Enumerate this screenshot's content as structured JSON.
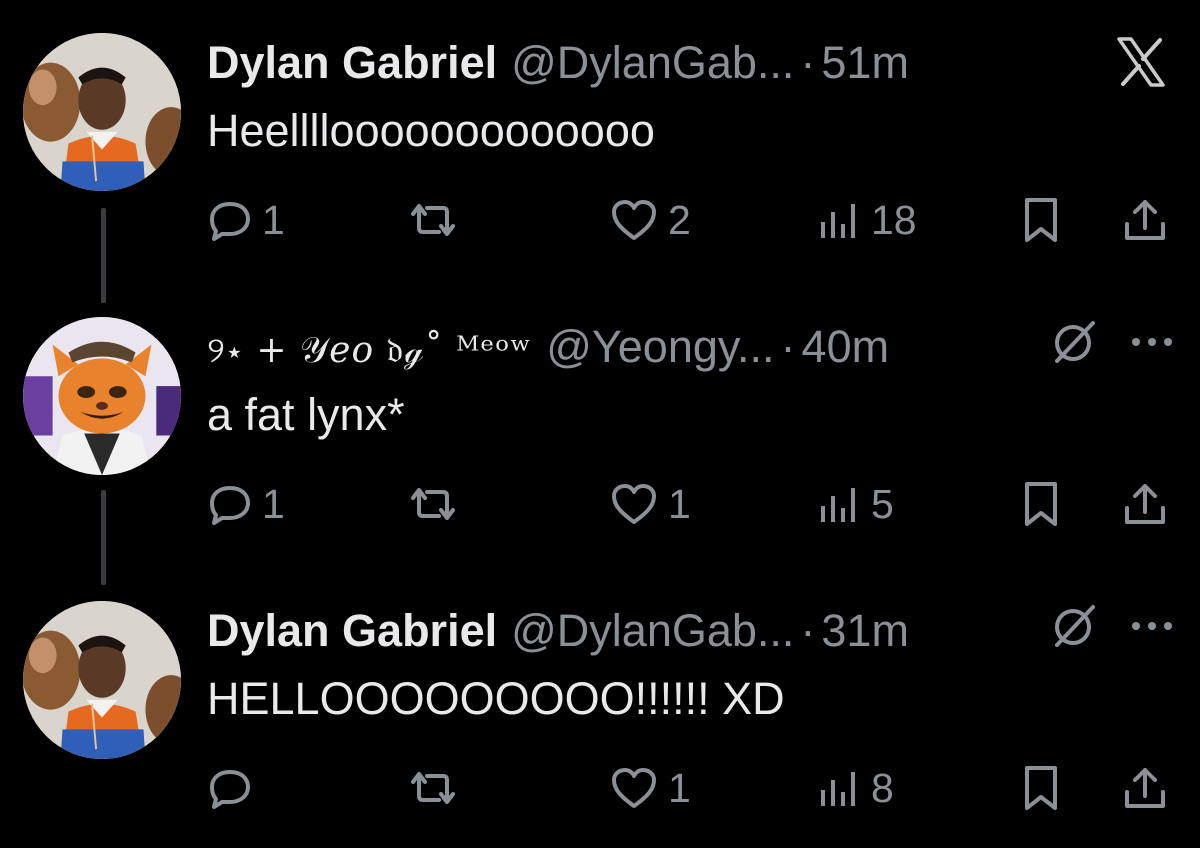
{
  "posts": [
    {
      "name": "Dylan Gabriel",
      "handle": "@DylanGab...",
      "separator": "·",
      "time": "51m",
      "text": "Heellllooooooooooooo",
      "corner_icon": "x-logo-icon",
      "avatar": "person-with-mascot-avatar",
      "replies": "1",
      "retweets": "",
      "likes": "2",
      "views": "18"
    },
    {
      "name": "୨⋆ + 𝒴𝑒𝑜 𝔡ℊ˚ ᴹᵉᵒʷ",
      "handle": "@Yeongy...",
      "separator": "·",
      "time": "40m",
      "text": "a fat lynx*",
      "corner_icon": "grok-icon",
      "more_icon": "more-icon",
      "avatar": "orange-lynx-character-avatar",
      "replies": "1",
      "retweets": "",
      "likes": "1",
      "views": "5"
    },
    {
      "name": "Dylan Gabriel",
      "handle": "@DylanGab...",
      "separator": "·",
      "time": "31m",
      "text": "HELLOOOOOOOOO!!!!!! XD",
      "corner_icon": "grok-icon",
      "more_icon": "more-icon",
      "avatar": "person-with-mascot-avatar",
      "replies": "",
      "retweets": "",
      "likes": "1",
      "views": "8"
    }
  ],
  "colors": {
    "background": "#000000",
    "text": "#e7e9ea",
    "muted": "#8b9096",
    "thread_line": "#3a3d40"
  }
}
